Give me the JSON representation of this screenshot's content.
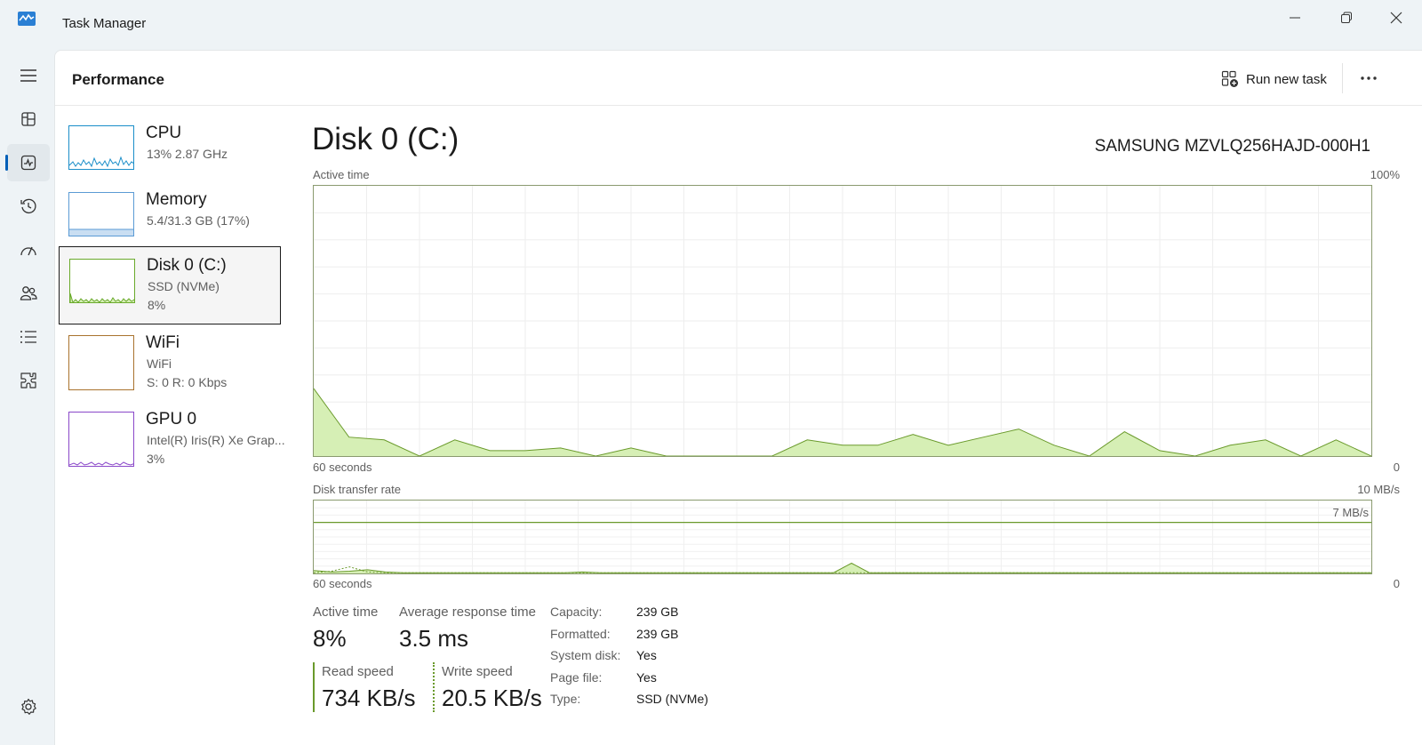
{
  "window": {
    "title": "Task Manager",
    "minimize_icon": "minimize-icon",
    "maximize_icon": "restore-icon",
    "close_icon": "close-icon"
  },
  "rail": {
    "items": [
      "hamburger-menu-icon",
      "processes-icon",
      "performance-icon",
      "app-history-icon",
      "startup-apps-icon",
      "users-icon",
      "details-icon",
      "services-icon",
      "settings-icon"
    ],
    "active": "performance-icon"
  },
  "header": {
    "title": "Performance",
    "run_task_label": "Run new task",
    "more_icon": "more-icon"
  },
  "devices": [
    {
      "name": "CPU",
      "line1": "13%  2.87 GHz",
      "line2": "",
      "accent": "#1b8ec9"
    },
    {
      "name": "Memory",
      "line1": "5.4/31.3 GB (17%)",
      "line2": "",
      "accent": "#5b9bd5"
    },
    {
      "name": "Disk 0 (C:)",
      "line1": "SSD (NVMe)",
      "line2": "8%",
      "accent": "#6aaa2b",
      "selected": true
    },
    {
      "name": "WiFi",
      "line1": "WiFi",
      "line2": "S: 0  R: 0 Kbps",
      "accent": "#a9722d"
    },
    {
      "name": "GPU 0",
      "line1": "Intel(R) Iris(R) Xe Grap...",
      "line2": "3%",
      "accent": "#8a48c9"
    }
  ],
  "detail": {
    "title": "Disk 0 (C:)",
    "model": "SAMSUNG MZVLQ256HAJD-000H1",
    "active_time_graph": {
      "label": "Active time",
      "max_label": "100%",
      "x_left_label": "60 seconds",
      "x_right_label": "0",
      "fill_color": "#d6efb5",
      "line_color": "#6a9a2b"
    },
    "transfer_graph": {
      "label": "Disk transfer rate",
      "max_label": "10 MB/s",
      "mid_label": "7 MB/s",
      "x_left_label": "60 seconds",
      "x_right_label": "0"
    },
    "stats": {
      "active_time_label": "Active time",
      "active_time_value": "8%",
      "avg_response_label": "Average response time",
      "avg_response_value": "3.5 ms",
      "read_speed_label": "Read speed",
      "read_speed_value": "734 KB/s",
      "write_speed_label": "Write speed",
      "write_speed_value": "20.5 KB/s"
    },
    "properties": [
      {
        "key": "Capacity:",
        "value": "239 GB"
      },
      {
        "key": "Formatted:",
        "value": "239 GB"
      },
      {
        "key": "System disk:",
        "value": "Yes"
      },
      {
        "key": "Page file:",
        "value": "Yes"
      },
      {
        "key": "Type:",
        "value": "SSD (NVMe)"
      }
    ]
  },
  "chart_data": [
    {
      "type": "area",
      "title": "Active time",
      "xlabel": "60 seconds",
      "ylim": [
        0,
        100
      ],
      "x": [
        60,
        58,
        56,
        54,
        52,
        50,
        48,
        46,
        44,
        42,
        40,
        38,
        36,
        34,
        32,
        30,
        28,
        26,
        24,
        22,
        20,
        18,
        16,
        14,
        12,
        10,
        8,
        6,
        4,
        2,
        0
      ],
      "series": [
        {
          "values": [
            25,
            7,
            6,
            0,
            6,
            2,
            2,
            3,
            0,
            3,
            0,
            0,
            0,
            0,
            6,
            4,
            4,
            8,
            4,
            7,
            10,
            4,
            0,
            9,
            2,
            0,
            4,
            6,
            0,
            6,
            0
          ]
        }
      ]
    },
    {
      "type": "line",
      "title": "Disk transfer rate",
      "xlabel": "60 seconds",
      "ylim": [
        0,
        10
      ],
      "series": [
        {
          "name": "Read speed",
          "values": [
            0.4,
            0.2,
            0.3,
            0.5,
            0.2,
            0.1,
            0.1,
            0.1,
            0.1,
            0.1,
            0.1,
            0.1,
            0.1,
            0.1,
            0.1,
            0.2,
            0.1,
            0.1,
            0.1,
            0.1,
            0.1,
            0.1,
            0.1,
            0.1,
            0.1,
            0.1,
            0.1,
            0.1,
            0.1,
            0.1,
            0.1,
            0.1,
            0.1,
            0.1,
            0.1,
            0.1,
            0.1,
            0.1,
            0.1,
            0.1,
            0.1,
            0.1,
            0.1,
            0.1,
            0.1,
            0.1,
            0.1,
            0.1,
            0.1,
            0.1,
            0.1,
            0.1,
            0.1,
            0.1,
            0.1,
            0.1,
            0.1,
            0.1,
            0.1,
            0.1
          ]
        },
        {
          "name": "Write speed",
          "values": [
            0.1,
            0.3,
            0.9,
            0.2,
            0.1,
            0.1,
            0.1,
            0.1,
            0.1,
            0.1,
            0.1,
            0.1,
            0.1,
            0.1,
            0.1,
            0.1,
            0.1,
            0.1,
            0.1,
            0.1,
            0.1,
            0.1,
            0.1,
            0.1,
            0.1,
            0.1,
            0.1,
            0.1,
            0.1,
            0.1,
            0.1,
            0.1,
            0.1,
            0.1,
            0.1,
            0.1,
            0.1,
            0.1,
            0.1,
            0.1,
            0.1,
            0.1,
            0.1,
            0.1,
            0.1,
            0.1,
            0.1,
            0.1,
            0.1,
            0.1,
            0.1,
            0.1,
            0.1,
            0.1,
            0.1,
            0.1,
            0.1,
            0.1,
            0.1,
            0.1
          ]
        }
      ]
    }
  ]
}
